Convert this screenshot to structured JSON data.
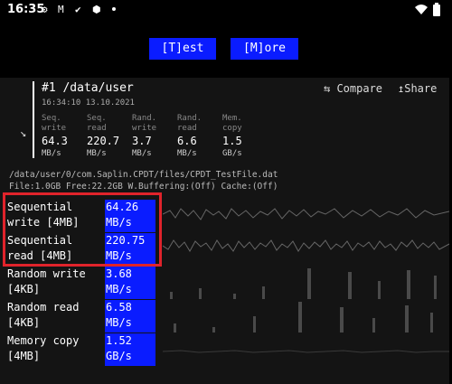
{
  "status": {
    "time": "16:35",
    "icons": [
      "gear-icon",
      "gmail-icon",
      "check-icon",
      "hexagon-icon",
      "dot-icon"
    ],
    "right_icons": [
      "wifi-icon",
      "battery-icon"
    ]
  },
  "toolbar": {
    "test_label": "[T]est",
    "more_label": "[M]ore"
  },
  "result": {
    "title": "#1 /data/user",
    "timestamp": "16:34:10 13.10.2021",
    "compare_label": "⇆ Compare",
    "share_label": "↥Share",
    "arrow": "↘",
    "columns": [
      {
        "label1": "Seq.",
        "label2": "write",
        "value": "64.3",
        "unit": "MB/s"
      },
      {
        "label1": "Seq.",
        "label2": "read",
        "value": "220.7",
        "unit": "MB/s"
      },
      {
        "label1": "Rand.",
        "label2": "write",
        "value": "3.7",
        "unit": "MB/s"
      },
      {
        "label1": "Rand.",
        "label2": "read",
        "value": "6.6",
        "unit": "MB/s"
      },
      {
        "label1": "Mem.",
        "label2": "copy",
        "value": "1.5",
        "unit": "GB/s"
      }
    ]
  },
  "file_info": {
    "path": "/data/user/0/com.Saplin.CPDT/files/CPDT_TestFile.dat",
    "details": "File:1.0GB Free:22.2GB W.Buffering:(Off) Cache:(Off)"
  },
  "tests": [
    {
      "label1": "Sequential",
      "label2": "write [4MB]",
      "value": "64.26",
      "unit": "MB/s"
    },
    {
      "label1": "Sequential",
      "label2": "read [4MB]",
      "value": "220.75",
      "unit": "MB/s"
    },
    {
      "label1": "Random write",
      "label2": "[4KB]",
      "value": "3.68",
      "unit": "MB/s"
    },
    {
      "label1": "Random read",
      "label2": "[4KB]",
      "value": "6.58",
      "unit": "MB/s"
    },
    {
      "label1": "Memory copy",
      "label2": "[4MB]",
      "value": "1.52",
      "unit": "GB/s"
    }
  ],
  "colors": {
    "accent": "#0a1cff",
    "highlight": "#e0232b",
    "panel": "#141414"
  }
}
